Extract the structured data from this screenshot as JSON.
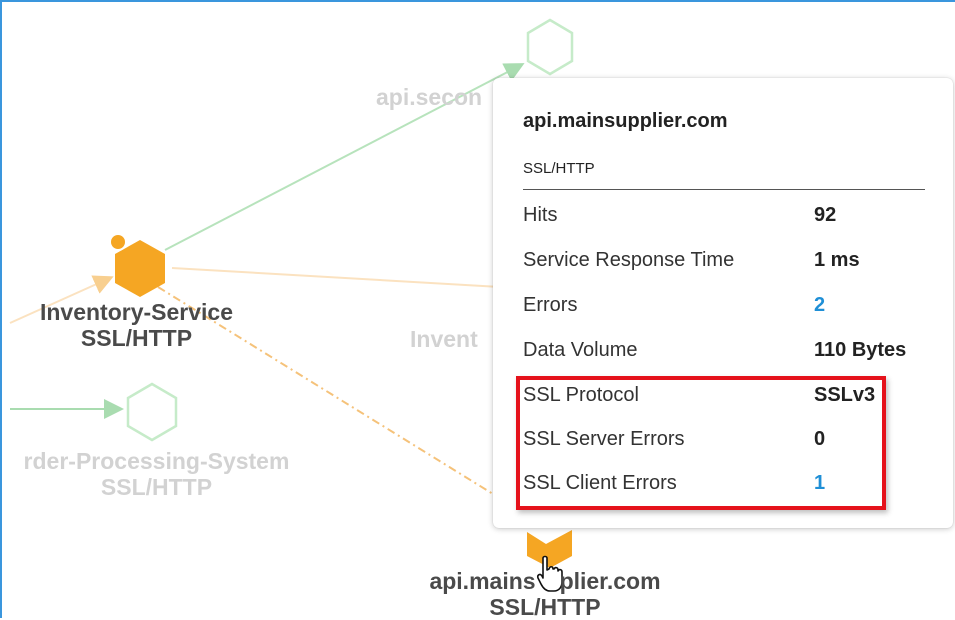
{
  "nodes": {
    "top_partial_label": "api.secon",
    "inventory_service": {
      "name": "Inventory-Service",
      "protocol": "SSL/HTTP"
    },
    "middle_partial_label": "Invent",
    "order_processing": {
      "name": "rder-Processing-System",
      "protocol": "SSL/HTTP"
    },
    "main_supplier": {
      "name_left": "api.mains",
      "name_right": "plier.com",
      "protocol": "SSL/HTTP"
    }
  },
  "tooltip": {
    "title": "api.mainsupplier.com",
    "subtitle": "SSL/HTTP",
    "rows": [
      {
        "label": "Hits",
        "value": "92"
      },
      {
        "label": "Service Response Time",
        "value": "1 ms"
      },
      {
        "label": "Errors",
        "value": "2"
      },
      {
        "label": "Data Volume",
        "value": "110 Bytes"
      },
      {
        "label": "SSL Protocol",
        "value": "SSLv3"
      },
      {
        "label": "SSL Server Errors",
        "value": "0"
      },
      {
        "label": "SSL Client Errors",
        "value": "1"
      }
    ]
  },
  "colors": {
    "accent_orange": "#f5a623",
    "link_blue": "#1f8fd6",
    "faded_green": "#c6ebc9",
    "highlight_red": "#e5121b"
  }
}
